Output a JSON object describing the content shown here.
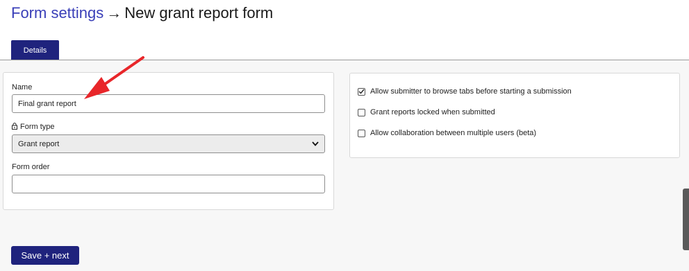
{
  "breadcrumb": {
    "parent": "Form settings",
    "separator": "→",
    "current": "New grant report form"
  },
  "tabs": [
    {
      "label": "Details",
      "active": true
    }
  ],
  "form": {
    "name": {
      "label": "Name",
      "value": "Final grant report"
    },
    "form_type": {
      "label": "Form type",
      "value": "Grant report",
      "locked": true
    },
    "form_order": {
      "label": "Form order",
      "value": ""
    }
  },
  "options": [
    {
      "label": "Allow submitter to browse tabs before starting a submission",
      "checked": true
    },
    {
      "label": "Grant reports locked when submitted",
      "checked": false
    },
    {
      "label": "Allow collaboration between multiple users (beta)",
      "checked": false
    }
  ],
  "actions": {
    "save_label": "Save + next"
  },
  "colors": {
    "primary": "#1f237d",
    "link": "#3a3fb8",
    "annotation_arrow": "#e8262a"
  }
}
